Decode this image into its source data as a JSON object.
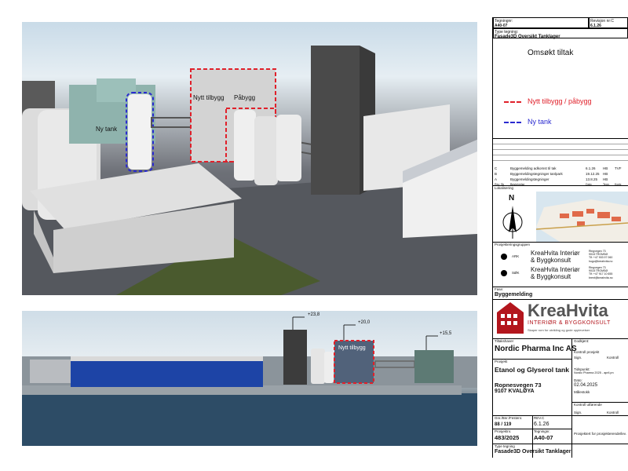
{
  "top_render": {
    "labels": {
      "nytt_tilbygg": "Nytt tilbygg",
      "pabygg": "Påbygg",
      "ny_tank": "Ny tank"
    }
  },
  "bottom_render": {
    "levels": [
      "+23,8",
      "+20,0",
      "+15,5"
    ],
    "label_nytt_tilbygg": "Nytt tilbygg"
  },
  "title_block": {
    "tegning_label": "Tegningnr:",
    "tegning_value": "A40-07",
    "revisjon_label": "Revisjon nr:C",
    "revisjon_value": "6.1.26",
    "type_label": "Type tegning:",
    "type_value": "Fasade3D Oversikt Tanklager",
    "omsokt": "Omsøkt tiltak",
    "legend": [
      {
        "label": "Nytt tilbygg / påbygg",
        "color": "#e0202a"
      },
      {
        "label": "Ny tank",
        "color": "#2a2ad0"
      }
    ],
    "revisions": [
      {
        "rev": "C",
        "desc": "Byggemelding adkomst til tak",
        "date": "6.1.26",
        "by": "HB",
        "ctrl": "TVF"
      },
      {
        "rev": "B",
        "desc": "Byggemeldingstegninger tanlpark",
        "date": "19.12.25",
        "by": "HB",
        "ctrl": ""
      },
      {
        "rev": "A",
        "desc": "Byggemeldingstegninger",
        "date": "13.8.25",
        "by": "HB",
        "ctrl": ""
      }
    ],
    "rev_headers": [
      "Rev",
      "Sk",
      "Beskrivelse",
      "Dato",
      "Tegn.",
      "Kontr."
    ],
    "lokalisering": "Lokalisering",
    "north": "N",
    "prosjekteringsgruppen": "Prosjekteringsgruppen",
    "team": [
      {
        "role": "ARK",
        "name": "KreaHvita Interiør & Byggkonsult",
        "address": "Ringvegen 73\n9018 TROMSØ\nTlf: +47 903 97 060\nhugo@kreahvita.no"
      },
      {
        "role": "SØK",
        "name": "KreaHvita Interiør & Byggkonsult",
        "address": "Ringvegen 73\n9018 TROMSØ\nTlf: +47 917 10 655\nbrent@kreahvita.no"
      }
    ],
    "fase_label": "Fase:",
    "fase_value": "Byggemelding",
    "logo_text": "KreaHvita",
    "logo_sub": "INTERIØR & BYGGKONSULT",
    "logo_tagline": "Skaper rom for utvikling og gode opplevelser",
    "tiltakshaver_label": "Tiltakshaver",
    "tiltakshaver_value": "Nordic Pharma Inc AS",
    "godkjent_label": "Godkjent:",
    "kontroll_prosjekt": "Kontroll prosjekt",
    "sign_label": "Sign.",
    "kontroll_label": "Kontroll",
    "prosjekt_label": "Prosjekt",
    "prosjekt_value": "Etanol og Glyserol tank",
    "address1": "Ropnesvegen 73",
    "address2": "9107 KVALØYA",
    "tidspunkt_label": "Tidspunkt:",
    "tidspunkt_value": "Nordic Pharma 2025 - april.pn",
    "dato_label": "Dato:",
    "dato_value": "02.04.2025",
    "malestokk_label": "Målestokk",
    "kontroll_utforende": "Kontroll utførende",
    "gnr_label": "Gnr./Bnr./Festenr.",
    "gnr_value": "88 / 119",
    "rev_label": "REV.C",
    "rev_value": "6.1.26",
    "prosjektnr_label": "Prosjektnr.",
    "prosjektnr_value": "483/2025",
    "tegningnr_label": "Tegningnr.",
    "tegningnr_value": "A40-07",
    "prosjektfor_label": "Prosjektert for prosjekterende/lev.",
    "type2_label": "Type tegning",
    "type2_value": "Fasade3D Oversikt Tanklager"
  }
}
